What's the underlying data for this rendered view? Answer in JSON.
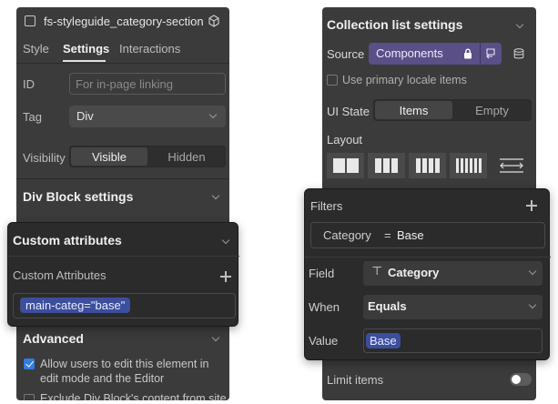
{
  "left": {
    "element_name": "fs-styleguide_category-section",
    "tabs": [
      "Style",
      "Settings",
      "Interactions"
    ],
    "active_tab": "Settings",
    "id_label": "ID",
    "id_placeholder": "For in-page linking",
    "tag_label": "Tag",
    "tag_value": "Div",
    "visibility_label": "Visibility",
    "visibility_options": [
      "Visible",
      "Hidden"
    ],
    "visibility_selected": "Visible",
    "div_block_settings": "Div Block settings",
    "custom_attributes": {
      "title": "Custom attributes",
      "subtitle": "Custom Attributes",
      "attribute": "main-categ=\"base\""
    },
    "advanced": {
      "title": "Advanced",
      "allow_edit": "Allow users to edit this element in edit mode and the Editor",
      "exclude_partial": "Exclude Div Block's content from site"
    }
  },
  "right": {
    "title": "Collection list settings",
    "source_label": "Source",
    "source_value": "Components",
    "primary_locale": "Use primary locale items",
    "ui_state_label": "UI State",
    "ui_state_options": [
      "Items",
      "Empty"
    ],
    "ui_state_selected": "Items",
    "layout_label": "Layout",
    "filters": {
      "title": "Filters",
      "summary_field": "Category",
      "summary_op": "=",
      "summary_value": "Base",
      "field_label": "Field",
      "field_value": "Category",
      "when_label": "When",
      "when_value": "Equals",
      "value_label": "Value",
      "value_value": "Base"
    },
    "limit_items": "Limit items"
  },
  "colors": {
    "panel_bg": "#3b3b3b",
    "popover_bg": "#2b2b2b",
    "accent_pill": "#3c4e9c",
    "checkbox_checked": "#2f7de1",
    "source_bg": "#5a4f86"
  },
  "icons": [
    "element-checkbox-icon",
    "component-icon",
    "chevron-down-icon",
    "plus-icon",
    "lock-icon",
    "swap-source-icon",
    "database-icon",
    "text-type-icon"
  ]
}
